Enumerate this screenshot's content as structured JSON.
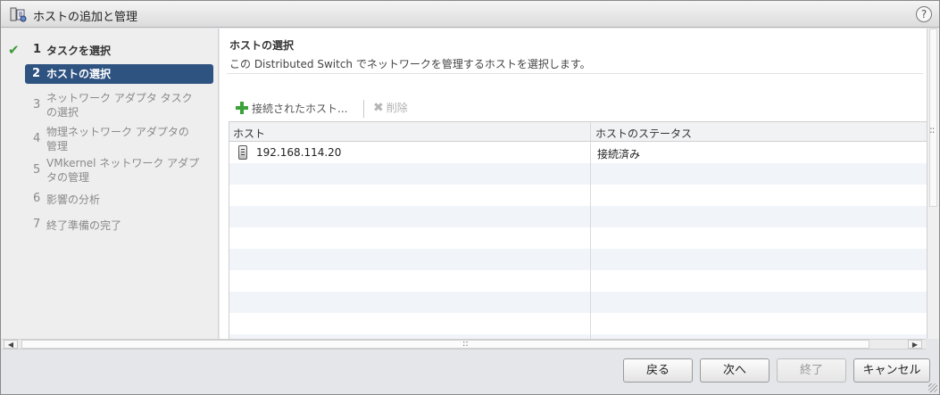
{
  "window": {
    "title": "ホストの追加と管理",
    "help_label": "?"
  },
  "nav": {
    "steps": [
      {
        "num": "1",
        "label": "タスクを選択",
        "state": "done"
      },
      {
        "num": "2",
        "label": "ホストの選択",
        "state": "current"
      },
      {
        "num": "3",
        "label_line1": "ネットワーク アダプタ タスク",
        "label_line2": "の選択",
        "state": "pending"
      },
      {
        "num": "4",
        "label_line1": "物理ネットワーク アダプタの",
        "label_line2": "管理",
        "state": "pending"
      },
      {
        "num": "5",
        "label_line1": "VMkernel ネットワーク アダプ",
        "label_line2": "タの管理",
        "state": "pending"
      },
      {
        "num": "6",
        "label": "影響の分析",
        "state": "pending"
      },
      {
        "num": "7",
        "label": "終了準備の完了",
        "state": "pending"
      }
    ]
  },
  "content": {
    "title": "ホストの選択",
    "description": "この Distributed Switch でネットワークを管理するホストを選択します。",
    "toolbar": {
      "add_label": "接続されたホスト...",
      "remove_label": "削除"
    },
    "table": {
      "columns": [
        "ホスト",
        "ホストのステータス"
      ],
      "rows": [
        {
          "host": "192.168.114.20",
          "status": "接続済み"
        }
      ]
    }
  },
  "footer": {
    "back_label": "戻る",
    "next_label": "次へ",
    "finish_label": "終了",
    "cancel_label": "キャンセル"
  },
  "colors": {
    "accent": "#2f5381",
    "check": "#3a9a3a",
    "add_icon": "#3aa23a"
  }
}
